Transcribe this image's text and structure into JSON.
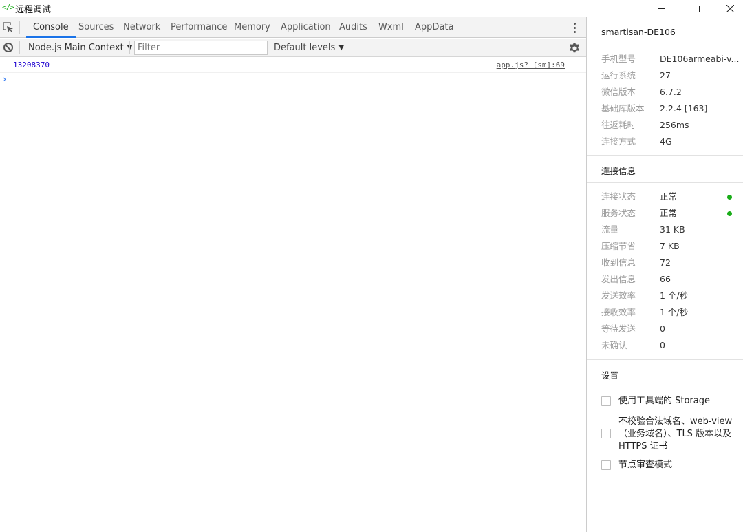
{
  "window": {
    "icon_text": "</>",
    "title": "远程调试"
  },
  "tabs": [
    {
      "label": "Console",
      "active": true
    },
    {
      "label": "Sources"
    },
    {
      "label": "Network"
    },
    {
      "label": "Performance"
    },
    {
      "label": "Memory"
    },
    {
      "label": "Application"
    },
    {
      "label": "Audits"
    },
    {
      "label": "Wxml"
    },
    {
      "label": "AppData"
    }
  ],
  "filterbar": {
    "context": "Node.js Main Context",
    "filter_placeholder": "Filter",
    "levels": "Default levels"
  },
  "console": {
    "log_value": "13208370",
    "log_source": "app.js? [sm]:69",
    "prompt": "›"
  },
  "sidebar": {
    "device": "smartisan-DE106",
    "device_info": [
      {
        "key": "手机型号",
        "value": "DE106armeabi-v..."
      },
      {
        "key": "运行系统",
        "value": "27"
      },
      {
        "key": "微信版本",
        "value": "6.7.2"
      },
      {
        "key": "基础库版本",
        "value": "2.2.4 [163]"
      },
      {
        "key": "往返耗时",
        "value": "256ms"
      },
      {
        "key": "连接方式",
        "value": "4G"
      }
    ],
    "connection_title": "连接信息",
    "connection_info": [
      {
        "key": "连接状态",
        "value": "正常",
        "dot": true
      },
      {
        "key": "服务状态",
        "value": "正常",
        "dot": true
      },
      {
        "key": "流量",
        "value": "31 KB"
      },
      {
        "key": "压缩节省",
        "value": "7 KB"
      },
      {
        "key": "收到信息",
        "value": "72"
      },
      {
        "key": "发出信息",
        "value": "66"
      },
      {
        "key": "发送效率",
        "value": "1 个/秒"
      },
      {
        "key": "接收效率",
        "value": "1 个/秒"
      },
      {
        "key": "等待发送",
        "value": "0"
      },
      {
        "key": "未确认",
        "value": "0"
      }
    ],
    "settings_title": "设置",
    "settings": [
      {
        "label": "使用工具端的 Storage",
        "checked": false
      },
      {
        "label": "不校验合法域名、web-view（业务域名）、TLS 版本以及 HTTPS 证书",
        "checked": false
      },
      {
        "label": "节点审查模式",
        "checked": false
      }
    ],
    "status_color": "#1aad19"
  }
}
